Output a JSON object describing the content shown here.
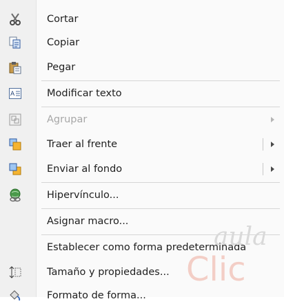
{
  "menu": {
    "items": [
      {
        "label": "Cortar",
        "icon": "scissors-icon"
      },
      {
        "label": "Copiar",
        "icon": "copy-icon"
      },
      {
        "label": "Pegar",
        "icon": "paste-icon"
      },
      {
        "label": "Modificar texto",
        "icon": "edit-text-icon"
      },
      {
        "label": "Agrupar",
        "icon": "group-icon",
        "disabled": true
      },
      {
        "label": "Traer al frente",
        "icon": "bring-to-front-icon"
      },
      {
        "label": "Enviar al fondo",
        "icon": "send-to-back-icon"
      },
      {
        "label": "Hipervínculo...",
        "icon": "hyperlink-icon"
      },
      {
        "label": "Asignar macro...",
        "icon": ""
      },
      {
        "label": "Establecer como forma predeterminada",
        "icon": ""
      },
      {
        "label": "Tamaño y propiedades...",
        "icon": "size-properties-icon"
      },
      {
        "label": "Formato de forma...",
        "icon": "format-shape-icon"
      }
    ]
  },
  "watermark": {
    "top": "aula",
    "bottom": "Clic"
  },
  "colors": {
    "accent": "#e34b2b",
    "watermark": "#d9d9d9"
  }
}
